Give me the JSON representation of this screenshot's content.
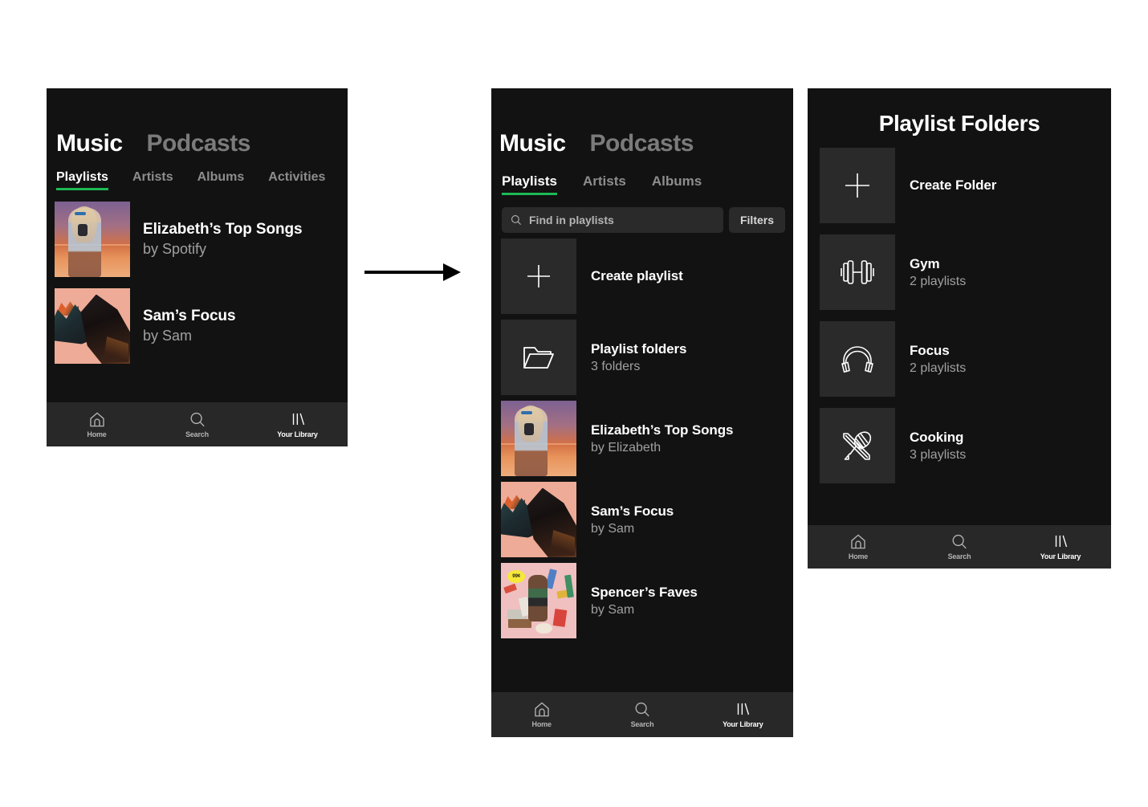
{
  "screen1": {
    "segments": [
      {
        "label": "Music",
        "active": true
      },
      {
        "label": "Podcasts",
        "active": false
      }
    ],
    "tabs": [
      {
        "label": "Playlists",
        "active": true
      },
      {
        "label": "Artists",
        "active": false
      },
      {
        "label": "Albums",
        "active": false
      },
      {
        "label": "Activities",
        "active": false
      }
    ],
    "items": [
      {
        "title": "Elizabeth’s Top Songs",
        "subtitle": "by Spotify",
        "art": "elizabeth-top-songs-cover"
      },
      {
        "title": "Sam’s Focus",
        "subtitle": "by Sam",
        "art": "sams-focus-cover"
      }
    ],
    "nav": [
      {
        "label": "Home",
        "icon": "home-icon",
        "active": false
      },
      {
        "label": "Search",
        "icon": "search-icon",
        "active": false
      },
      {
        "label": "Your Library",
        "icon": "library-icon",
        "active": true
      }
    ]
  },
  "screen2": {
    "segments": [
      {
        "label": "Music",
        "active": true
      },
      {
        "label": "Podcasts",
        "active": false
      }
    ],
    "tabs": [
      {
        "label": "Playlists",
        "active": true
      },
      {
        "label": "Artists",
        "active": false
      },
      {
        "label": "Albums",
        "active": false
      }
    ],
    "search": {
      "placeholder": "Find in playlists",
      "icon": "search-icon"
    },
    "filters_label": "Filters",
    "items": [
      {
        "title": "Create playlist",
        "subtitle": "",
        "art": "plus-icon"
      },
      {
        "title": "Playlist folders",
        "subtitle": "3 folders",
        "art": "folder-icon"
      },
      {
        "title": "Elizabeth’s Top Songs",
        "subtitle": "by Elizabeth",
        "art": "elizabeth-top-songs-cover"
      },
      {
        "title": "Sam’s Focus",
        "subtitle": "by Sam",
        "art": "sams-focus-cover"
      },
      {
        "title": "Spencer’s Faves",
        "subtitle": "by Sam",
        "art": "spencers-faves-cover"
      }
    ],
    "nav": [
      {
        "label": "Home",
        "icon": "home-icon",
        "active": false
      },
      {
        "label": "Search",
        "icon": "search-icon",
        "active": false
      },
      {
        "label": "Your Library",
        "icon": "library-icon",
        "active": true
      }
    ]
  },
  "screen3": {
    "title": "Playlist Folders",
    "items": [
      {
        "title": "Create Folder",
        "subtitle": "",
        "art": "plus-icon"
      },
      {
        "title": "Gym",
        "subtitle": "2 playlists",
        "art": "dumbbell-icon"
      },
      {
        "title": "Focus",
        "subtitle": "2 playlists",
        "art": "headphones-icon"
      },
      {
        "title": "Cooking",
        "subtitle": "3 playlists",
        "art": "whisk-rollingpin-icon"
      }
    ],
    "nav": [
      {
        "label": "Home",
        "icon": "home-icon",
        "active": false
      },
      {
        "label": "Search",
        "icon": "search-icon",
        "active": false
      },
      {
        "label": "Your Library",
        "icon": "library-icon",
        "active": true
      }
    ]
  },
  "flow": {
    "arrow": "right-arrow-icon"
  },
  "colors": {
    "background": "#ffffff",
    "screen_bg": "#121212",
    "nav_bg": "#282828",
    "tile_bg": "#2a2a2a",
    "accent": "#1db954",
    "text_primary": "#ffffff",
    "text_secondary": "#a0a0a0"
  }
}
